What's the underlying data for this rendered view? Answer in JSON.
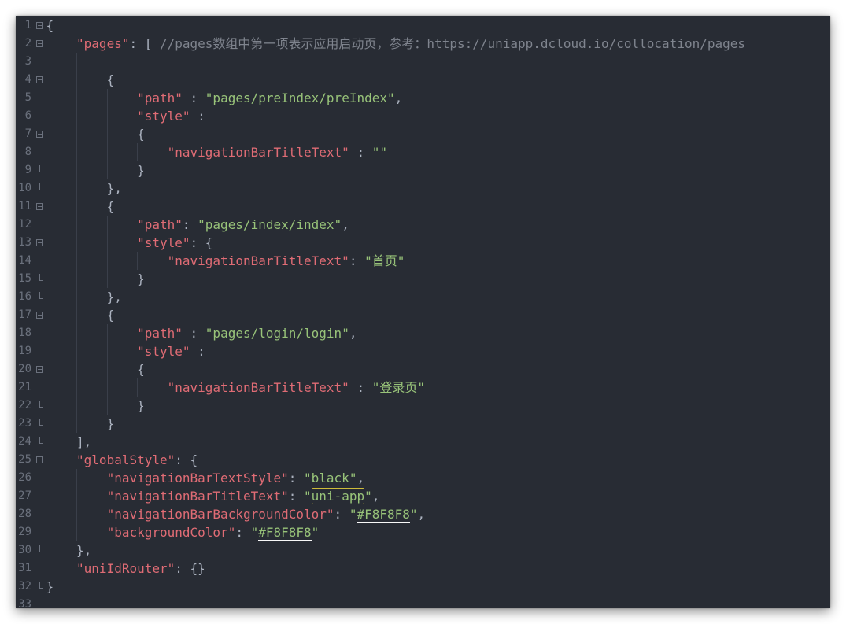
{
  "editor": {
    "theme": {
      "page_background": "#ffffff",
      "background": "#282c34",
      "key": "#e06c75",
      "str": "#98c379",
      "punc": "#abb2bf",
      "cmt": "#7f848e",
      "line_number": "#6b717d",
      "indent_guide": "#3a3f4a",
      "find_match_border": "#cdbb3a"
    },
    "lines": [
      {
        "num": "1",
        "fold": "open",
        "indent": 0,
        "tokens": [
          {
            "t": "{",
            "k": "punc"
          }
        ]
      },
      {
        "num": "2",
        "fold": "open",
        "indent": 1,
        "tokens": [
          {
            "t": "\"pages\"",
            "k": "key"
          },
          {
            "t": ": [ ",
            "k": "punc"
          },
          {
            "t": "//pages数组中第一项表示应用启动页，参考：https://uniapp.dcloud.io/collocation/pages",
            "k": "cmt"
          }
        ]
      },
      {
        "num": "3",
        "fold": null,
        "indent": 2,
        "tokens": []
      },
      {
        "num": "4",
        "fold": "open",
        "indent": 2,
        "tokens": [
          {
            "t": "{",
            "k": "punc"
          }
        ]
      },
      {
        "num": "5",
        "fold": null,
        "indent": 3,
        "tokens": [
          {
            "t": "\"path\"",
            "k": "key"
          },
          {
            "t": " : ",
            "k": "punc"
          },
          {
            "t": "\"pages/preIndex/preIndex\"",
            "k": "str"
          },
          {
            "t": ",",
            "k": "punc"
          }
        ]
      },
      {
        "num": "6",
        "fold": null,
        "indent": 3,
        "tokens": [
          {
            "t": "\"style\"",
            "k": "key"
          },
          {
            "t": " :",
            "k": "punc"
          }
        ]
      },
      {
        "num": "7",
        "fold": "open",
        "indent": 3,
        "tokens": [
          {
            "t": "{",
            "k": "punc"
          }
        ]
      },
      {
        "num": "8",
        "fold": null,
        "indent": 4,
        "tokens": [
          {
            "t": "\"navigationBarTitleText\"",
            "k": "key"
          },
          {
            "t": " : ",
            "k": "punc"
          },
          {
            "t": "\"\"",
            "k": "str"
          }
        ]
      },
      {
        "num": "9",
        "fold": "end",
        "indent": 3,
        "tokens": [
          {
            "t": "}",
            "k": "punc"
          }
        ]
      },
      {
        "num": "10",
        "fold": "end",
        "indent": 2,
        "tokens": [
          {
            "t": "},",
            "k": "punc"
          }
        ]
      },
      {
        "num": "11",
        "fold": "open",
        "indent": 2,
        "tokens": [
          {
            "t": "{",
            "k": "punc"
          }
        ]
      },
      {
        "num": "12",
        "fold": null,
        "indent": 3,
        "tokens": [
          {
            "t": "\"path\"",
            "k": "key"
          },
          {
            "t": ": ",
            "k": "punc"
          },
          {
            "t": "\"pages/index/index\"",
            "k": "str"
          },
          {
            "t": ",",
            "k": "punc"
          }
        ]
      },
      {
        "num": "13",
        "fold": "open",
        "indent": 3,
        "tokens": [
          {
            "t": "\"style\"",
            "k": "key"
          },
          {
            "t": ": {",
            "k": "punc"
          }
        ]
      },
      {
        "num": "14",
        "fold": null,
        "indent": 4,
        "tokens": [
          {
            "t": "\"navigationBarTitleText\"",
            "k": "key"
          },
          {
            "t": ": ",
            "k": "punc"
          },
          {
            "t": "\"首页\"",
            "k": "str"
          }
        ]
      },
      {
        "num": "15",
        "fold": "end",
        "indent": 3,
        "tokens": [
          {
            "t": "}",
            "k": "punc"
          }
        ]
      },
      {
        "num": "16",
        "fold": "end",
        "indent": 2,
        "tokens": [
          {
            "t": "},",
            "k": "punc"
          }
        ]
      },
      {
        "num": "17",
        "fold": "open",
        "indent": 2,
        "tokens": [
          {
            "t": "{",
            "k": "punc"
          }
        ]
      },
      {
        "num": "18",
        "fold": null,
        "indent": 3,
        "tokens": [
          {
            "t": "\"path\"",
            "k": "key"
          },
          {
            "t": " : ",
            "k": "punc"
          },
          {
            "t": "\"pages/login/login\"",
            "k": "str"
          },
          {
            "t": ",",
            "k": "punc"
          }
        ]
      },
      {
        "num": "19",
        "fold": null,
        "indent": 3,
        "tokens": [
          {
            "t": "\"style\"",
            "k": "key"
          },
          {
            "t": " :",
            "k": "punc"
          }
        ]
      },
      {
        "num": "20",
        "fold": "open",
        "indent": 3,
        "tokens": [
          {
            "t": "{",
            "k": "punc"
          }
        ]
      },
      {
        "num": "21",
        "fold": null,
        "indent": 4,
        "tokens": [
          {
            "t": "\"navigationBarTitleText\"",
            "k": "key"
          },
          {
            "t": " : ",
            "k": "punc"
          },
          {
            "t": "\"登录页\"",
            "k": "str"
          }
        ]
      },
      {
        "num": "22",
        "fold": "end",
        "indent": 3,
        "tokens": [
          {
            "t": "}",
            "k": "punc"
          }
        ]
      },
      {
        "num": "23",
        "fold": "end",
        "indent": 2,
        "tokens": [
          {
            "t": "}",
            "k": "punc"
          }
        ]
      },
      {
        "num": "24",
        "fold": "end",
        "indent": 1,
        "tokens": [
          {
            "t": "],",
            "k": "punc"
          }
        ]
      },
      {
        "num": "25",
        "fold": "open",
        "indent": 1,
        "tokens": [
          {
            "t": "\"globalStyle\"",
            "k": "key"
          },
          {
            "t": ": {",
            "k": "punc"
          }
        ]
      },
      {
        "num": "26",
        "fold": null,
        "indent": 2,
        "tokens": [
          {
            "t": "\"navigationBarTextStyle\"",
            "k": "key"
          },
          {
            "t": ": ",
            "k": "punc"
          },
          {
            "t": "\"black\"",
            "k": "str"
          },
          {
            "t": ",",
            "k": "punc"
          }
        ]
      },
      {
        "num": "27",
        "fold": null,
        "indent": 2,
        "tokens": [
          {
            "t": "\"navigationBarTitleText\"",
            "k": "key"
          },
          {
            "t": ": ",
            "k": "punc"
          },
          {
            "t": "\"",
            "k": "str"
          },
          {
            "t": "uni-app",
            "k": "str",
            "mark": "find-match"
          },
          {
            "t": "\"",
            "k": "str"
          },
          {
            "t": ",",
            "k": "punc"
          }
        ]
      },
      {
        "num": "28",
        "fold": null,
        "indent": 2,
        "tokens": [
          {
            "t": "\"navigationBarBackgroundColor\"",
            "k": "key"
          },
          {
            "t": ": ",
            "k": "punc"
          },
          {
            "t": "\"",
            "k": "str"
          },
          {
            "t": "#F8F8F8",
            "k": "str",
            "mark": "color-swatch"
          },
          {
            "t": "\"",
            "k": "str"
          },
          {
            "t": ",",
            "k": "punc"
          }
        ]
      },
      {
        "num": "29",
        "fold": null,
        "indent": 2,
        "tokens": [
          {
            "t": "\"backgroundColor\"",
            "k": "key"
          },
          {
            "t": ": ",
            "k": "punc"
          },
          {
            "t": "\"",
            "k": "str"
          },
          {
            "t": "#F8F8F8",
            "k": "str",
            "mark": "color-swatch"
          },
          {
            "t": "\"",
            "k": "str"
          }
        ]
      },
      {
        "num": "30",
        "fold": "end",
        "indent": 1,
        "tokens": [
          {
            "t": "},",
            "k": "punc"
          }
        ]
      },
      {
        "num": "31",
        "fold": null,
        "indent": 1,
        "tokens": [
          {
            "t": "\"uniIdRouter\"",
            "k": "key"
          },
          {
            "t": ": {}",
            "k": "punc"
          }
        ]
      },
      {
        "num": "32",
        "fold": "end",
        "indent": 0,
        "tokens": [
          {
            "t": "}",
            "k": "punc"
          }
        ]
      },
      {
        "num": "33",
        "fold": null,
        "indent": 0,
        "tokens": []
      }
    ]
  }
}
